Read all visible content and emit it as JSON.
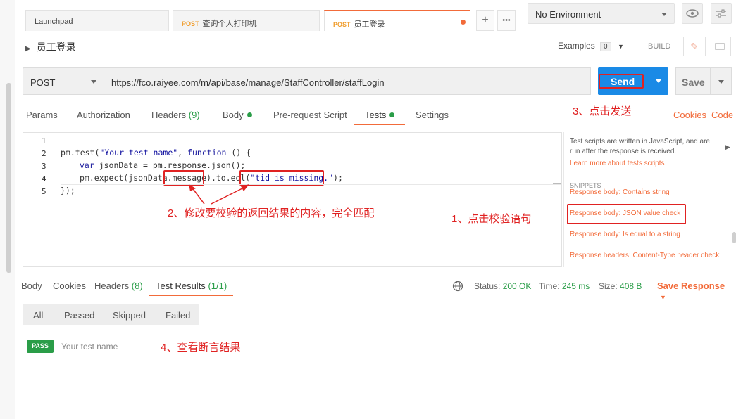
{
  "tabs": [
    {
      "method": "",
      "label": "Launchpad"
    },
    {
      "method": "POST",
      "label": "查询个人打印机"
    },
    {
      "method": "POST",
      "label": "员工登录"
    }
  ],
  "environment": {
    "selected": "No Environment"
  },
  "request": {
    "name": "员工登录",
    "examples_label": "Examples",
    "examples_count": "0",
    "build_label": "BUILD",
    "method": "POST",
    "url": "https://fco.raiyee.com/m/api/base/manage/StaffController/staffLogin",
    "send_label": "Send",
    "save_label": "Save"
  },
  "request_tabs": {
    "params": "Params",
    "authorization": "Authorization",
    "headers": "Headers",
    "headers_count": "(9)",
    "body": "Body",
    "prerequest": "Pre-request Script",
    "tests": "Tests",
    "settings": "Settings",
    "cookies": "Cookies",
    "code": "Code"
  },
  "editor": {
    "line_numbers": [
      "1",
      "2",
      "3",
      "4",
      "5"
    ],
    "line2_a": "pm.test(",
    "line2_str": "\"Your test name\"",
    "line2_b": ", ",
    "line2_kw": "function",
    "line2_c": " () {",
    "line3_kw": "var",
    "line3_rest": " jsonData = pm.response.json();",
    "line4_a": "pm.expect(jsonData",
    "line4_msg": ".message",
    "line4_b": ").to.eql(",
    "line4_str": "\"tid is missing.\"",
    "line4_c": ");",
    "line5": "});"
  },
  "side_panel": {
    "help_text": "Test scripts are written in JavaScript, and are run after the response is received.",
    "learn_more": "Learn more about tests scripts",
    "snippets_header": "SNIPPETS",
    "snippets": [
      "Response body: Contains string",
      "Response body: JSON value check",
      "Response body: Is equal to a string",
      "Response headers: Content-Type header check"
    ]
  },
  "annotations": {
    "a1": "1、点击校验语句",
    "a2": "2、修改要校验的返回结果的内容，完全匹配",
    "a3": "3、点击发送",
    "a4": "4、查看断言结果"
  },
  "response": {
    "tabs": {
      "body": "Body",
      "cookies": "Cookies",
      "headers": "Headers",
      "headers_count": "(8)",
      "test_results": "Test Results",
      "test_results_count": "(1/1)"
    },
    "status_label": "Status:",
    "status_value": "200 OK",
    "time_label": "Time:",
    "time_value": "245 ms",
    "size_label": "Size:",
    "size_value": "408 B",
    "save_response": "Save Response",
    "filters": [
      "All",
      "Passed",
      "Skipped",
      "Failed"
    ],
    "result_badge": "PASS",
    "result_name": "Your test name"
  },
  "colors": {
    "accent": "#f26b3a",
    "send": "#1a8ae6",
    "pass": "#2a9d48",
    "annotation": "#e02222"
  }
}
